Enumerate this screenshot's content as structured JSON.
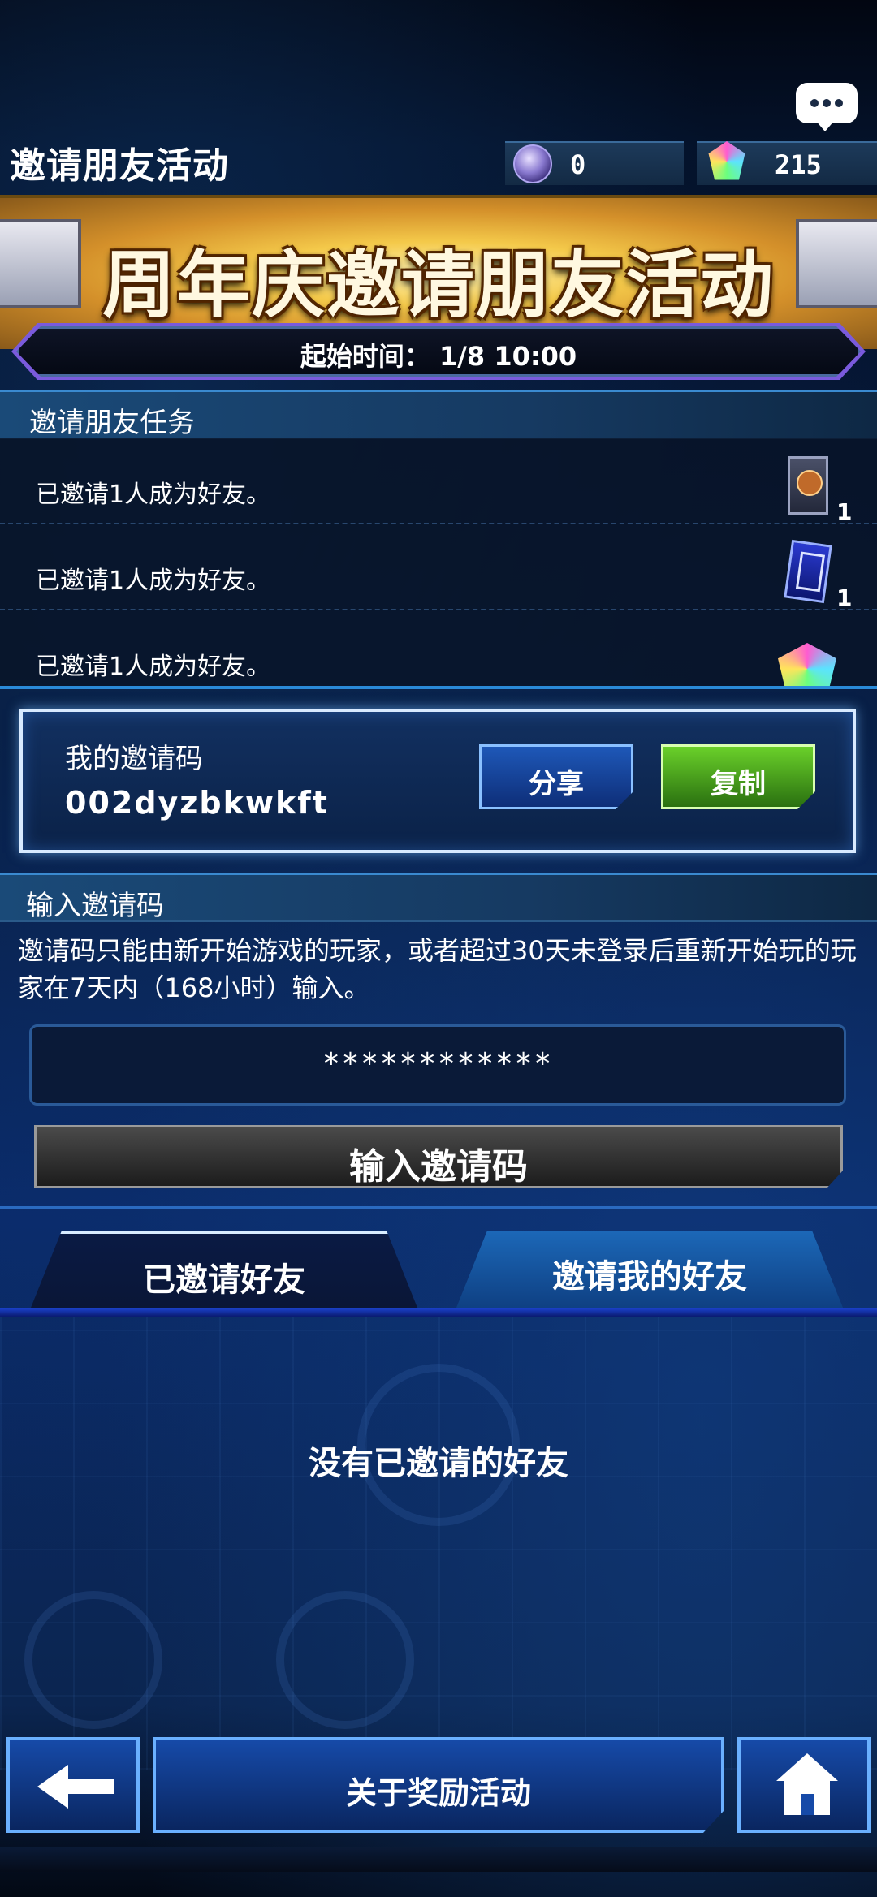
{
  "header": {
    "title": "邀请朋友活动",
    "orb_count": "0",
    "gem_count": "215"
  },
  "banner": {
    "title": "周年庆邀请朋友活动",
    "start_time": "起始时间：  1/8 10:00"
  },
  "missions": {
    "section_title": "邀请朋友任务",
    "items": [
      {
        "text": "已邀请1人成为好友。",
        "reward_icon": "card-pack-icon",
        "count": "1"
      },
      {
        "text": "已邀请1人成为好友。",
        "reward_icon": "card-icon",
        "count": "1"
      },
      {
        "text": "已邀请1人成为好友。",
        "reward_icon": "gem-icon",
        "count": ""
      }
    ]
  },
  "my_code": {
    "label": "我的邀请码",
    "value": "002dyzbkwkft",
    "share_label": "分享",
    "copy_label": "复制"
  },
  "enter_code": {
    "section_title": "输入邀请码",
    "description": "邀请码只能由新开始游戏的玩家，或者超过30天未登录后重新开始玩的玩家在7天内（168小时）输入。",
    "input_value": "************",
    "button_label": "输入邀请码"
  },
  "tabs": {
    "invited": "已邀请好友",
    "inviter": "邀请我的好友"
  },
  "empty_message": "没有已邀请的好友",
  "footer": {
    "about_label": "关于奖励活动"
  },
  "colors": {
    "accent_blue": "#1e58b8",
    "copy_green": "#6ad02a",
    "banner_gold": "#f4c94a"
  }
}
